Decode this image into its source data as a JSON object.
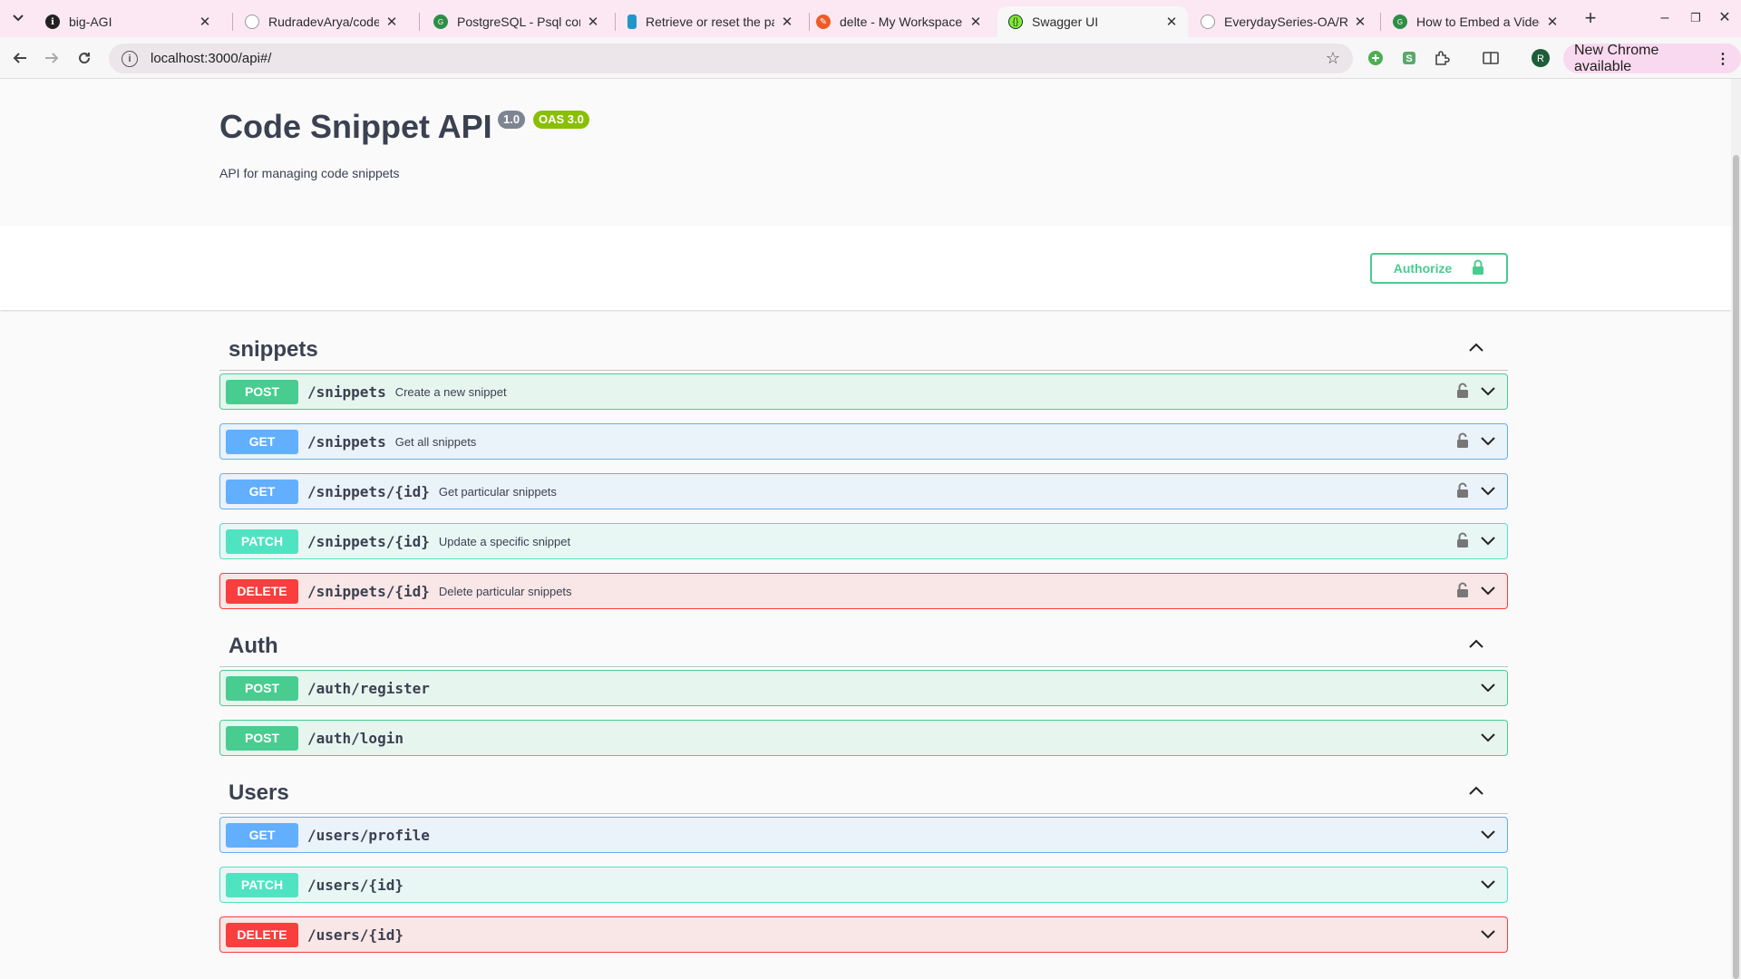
{
  "browser": {
    "tabs": [
      {
        "title": "big-AGI",
        "icon": "big-agi-icon",
        "color": "#222222"
      },
      {
        "title": "RudradevArya/codeinbox",
        "icon": "github-icon",
        "color": "#ffffff"
      },
      {
        "title": "PostgreSQL - Psql comm",
        "icon": "gfg-icon",
        "color": "#2f8d46"
      },
      {
        "title": "Retrieve or reset the pa",
        "icon": "db-icon",
        "color": "#2396c8"
      },
      {
        "title": "delte - My Workspace",
        "icon": "postman-icon",
        "color": "#ef5b25"
      },
      {
        "title": "Swagger UI",
        "icon": "swagger-icon",
        "color": "#85ea2d"
      },
      {
        "title": "EverydaySeries-OA/REA",
        "icon": "github-icon",
        "color": "#ffffff"
      },
      {
        "title": "How to Embed a Video i",
        "icon": "gfg-icon",
        "color": "#2f8d46"
      }
    ],
    "active_tab": "Swagger UI",
    "url": "localhost:3000/api#/",
    "new_chrome_label": "New Chrome available",
    "profile_initial": "R"
  },
  "api": {
    "title": "Code Snippet API",
    "version": "1.0",
    "oas": "OAS 3.0",
    "description": "API for managing code snippets",
    "authorize_label": "Authorize"
  },
  "tags": [
    {
      "name": "snippets",
      "operations": [
        {
          "method": "POST",
          "path": "/snippets",
          "summary": "Create a new snippet",
          "locked": true
        },
        {
          "method": "GET",
          "path": "/snippets",
          "summary": "Get all snippets",
          "locked": true
        },
        {
          "method": "GET",
          "path": "/snippets/{id}",
          "summary": "Get particular snippets",
          "locked": true
        },
        {
          "method": "PATCH",
          "path": "/snippets/{id}",
          "summary": "Update a specific snippet",
          "locked": true
        },
        {
          "method": "DELETE",
          "path": "/snippets/{id}",
          "summary": "Delete particular snippets",
          "locked": true
        }
      ]
    },
    {
      "name": "Auth",
      "operations": [
        {
          "method": "POST",
          "path": "/auth/register",
          "summary": "",
          "locked": false
        },
        {
          "method": "POST",
          "path": "/auth/login",
          "summary": "",
          "locked": false
        }
      ]
    },
    {
      "name": "Users",
      "operations": [
        {
          "method": "GET",
          "path": "/users/profile",
          "summary": "",
          "locked": false
        },
        {
          "method": "PATCH",
          "path": "/users/{id}",
          "summary": "",
          "locked": false
        },
        {
          "method": "DELETE",
          "path": "/users/{id}",
          "summary": "",
          "locked": false
        }
      ]
    }
  ],
  "colors": {
    "post": "#49cc90",
    "get": "#61affe",
    "patch": "#50e3c2",
    "delete": "#f93e3e",
    "version_badge": "#7d8492",
    "oas_badge": "#89bf04"
  }
}
